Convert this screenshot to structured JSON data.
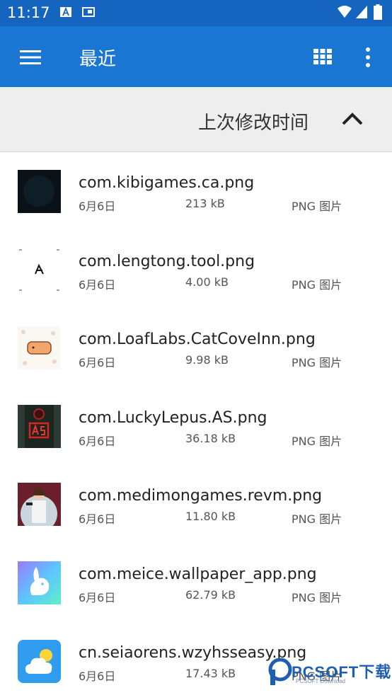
{
  "status_bar": {
    "time": "11:17"
  },
  "app_bar": {
    "title": "最近"
  },
  "sort_bar": {
    "label": "上次修改时间"
  },
  "files": [
    {
      "name": "com.kibigames.ca.png",
      "date": "6月6日",
      "size": "213 kB",
      "type": "PNG 图片"
    },
    {
      "name": "com.lengtong.tool.png",
      "date": "6月6日",
      "size": "4.00 kB",
      "type": "PNG 图片"
    },
    {
      "name": "com.LoafLabs.CatCoveInn.png",
      "date": "6月6日",
      "size": "9.98 kB",
      "type": "PNG 图片"
    },
    {
      "name": "com.LuckyLepus.AS.png",
      "date": "6月6日",
      "size": "36.18 kB",
      "type": "PNG 图片"
    },
    {
      "name": "com.medimongames.revm.png",
      "date": "6月6日",
      "size": "11.80 kB",
      "type": "PNG 图片"
    },
    {
      "name": "com.meice.wallpaper_app.png",
      "date": "6月6日",
      "size": "62.79 kB",
      "type": "PNG 图片"
    },
    {
      "name": "cn.seiaorens.wzyhsseasy.png",
      "date": "6月6日",
      "size": "17.43 kB",
      "type": "PNG 图片"
    }
  ],
  "watermark": {
    "text": "PCSOFT下载",
    "sub": "PCSOFT Download"
  },
  "colors": {
    "status_bar": "#1565c0",
    "app_bar": "#1976d2",
    "sort_bar": "#eeeeee"
  }
}
